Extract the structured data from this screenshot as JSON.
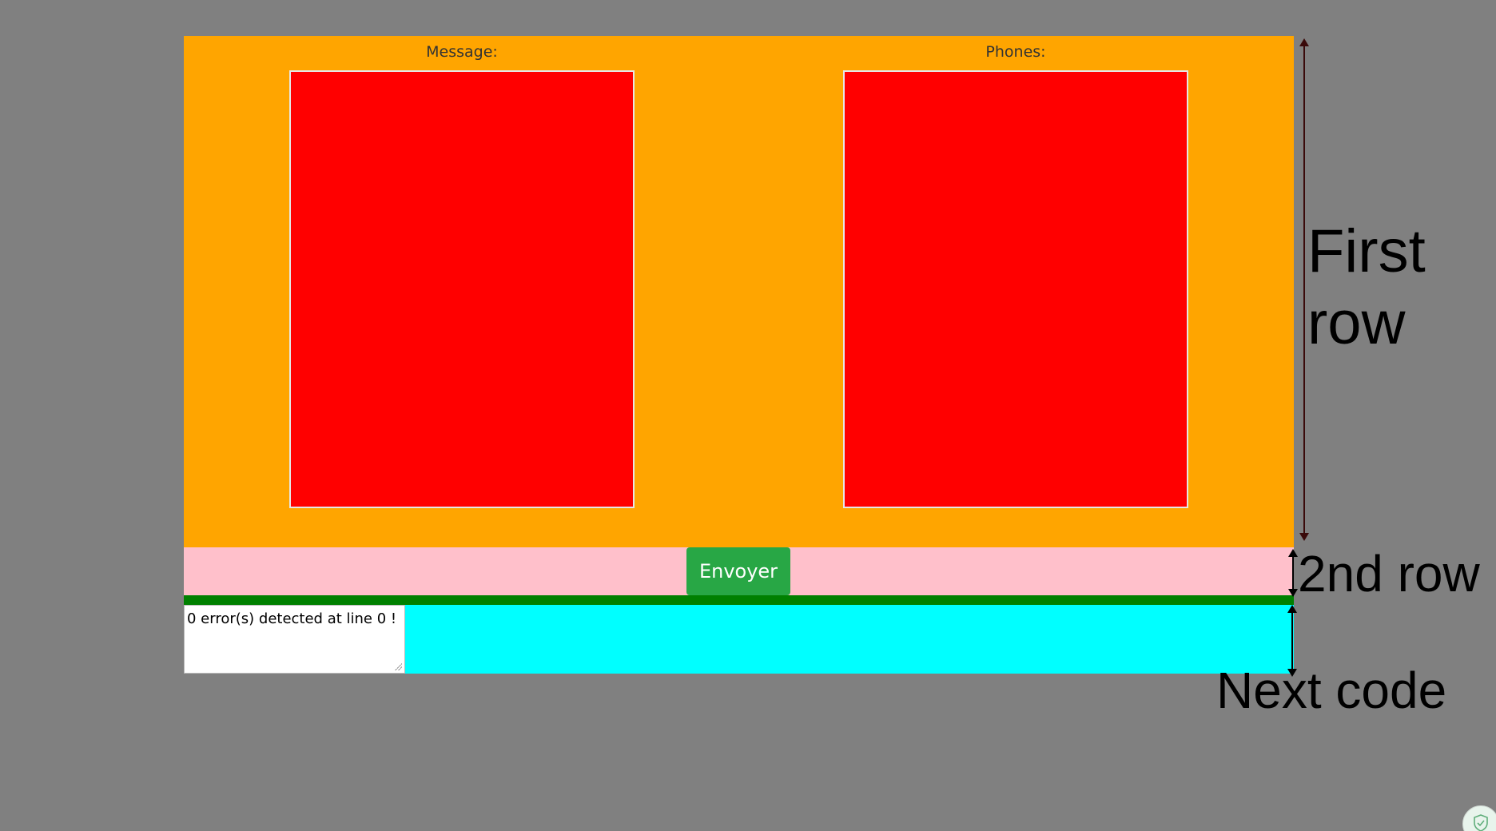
{
  "form": {
    "message_label": "Message:",
    "phones_label": "Phones:",
    "message_value": "",
    "phones_value": "",
    "send_label": "Envoyer",
    "error_text": "0 error(s) detected at line 0 !"
  },
  "annotations": {
    "first_row": "First\nrow",
    "second_row": "2nd row",
    "next_code": "Next code"
  },
  "colors": {
    "page_background": "#808080",
    "first_row": "#ffa500",
    "textbox": "#ff0000",
    "second_row": "#ffc0cb",
    "button": "#28a745",
    "separator": "#008000",
    "third_row": "#00ffff"
  },
  "icons": {
    "corner_badge": "shield-check-icon"
  }
}
